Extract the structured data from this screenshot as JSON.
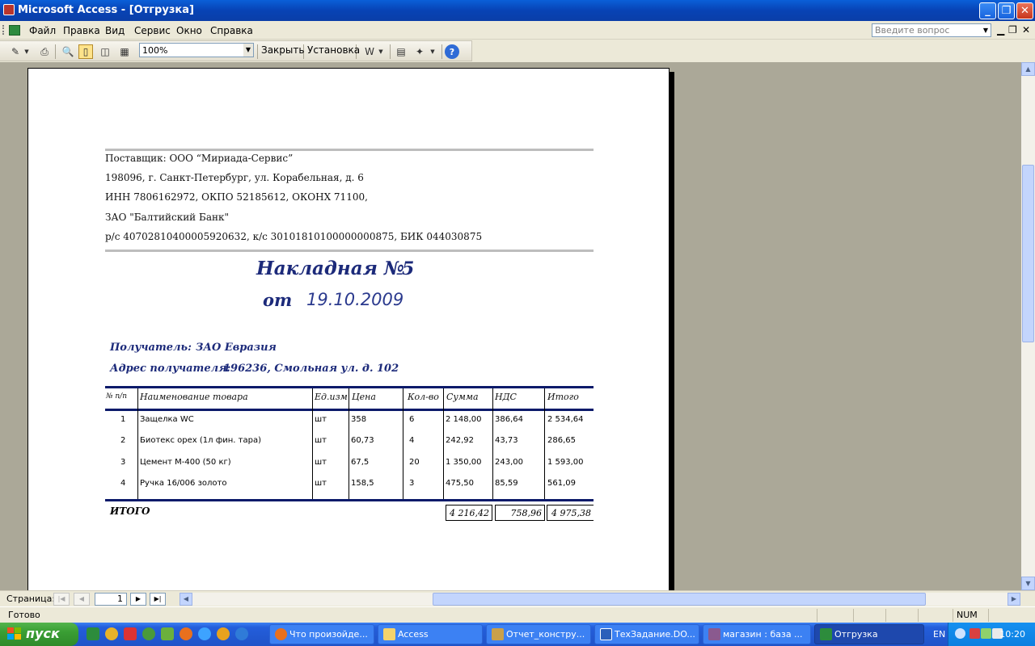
{
  "window": {
    "title": "Microsoft Access - [Отгрузка]",
    "minimize_glyph": "_",
    "restore_glyph": "❐",
    "close_glyph": "✕"
  },
  "menubar": {
    "items": [
      {
        "label": "Файл"
      },
      {
        "label": "Правка"
      },
      {
        "label": "Вид"
      },
      {
        "label": "Сервис"
      },
      {
        "label": "Окно"
      },
      {
        "label": "Справка"
      }
    ],
    "ask_placeholder": "Введите вопрос",
    "mdi_min": "▁",
    "mdi_restore": "❐",
    "mdi_close": "✕"
  },
  "toolbar": {
    "zoom": "100%",
    "close_label": "Закрыть",
    "setup_label": "Установка"
  },
  "report": {
    "supplier_lines": [
      "Поставщик: ООО “Мириада-Сервис”",
      "198096, г. Санкт-Петербург, ул. Корабельная, д. 6",
      "ИНН 7806162972, ОКПО 52185612, ОКОНХ 71100,",
      "ЗАО \"Балтийский Банк\"",
      "р/с 40702810400005920632, к/с 30101810100000000875, БИК 044030875"
    ],
    "title": "Накладная №",
    "number": "5",
    "from_label": "от",
    "date": "19.10.2009",
    "recipient_label": "Получатель:",
    "recipient": "ЗАО Евразия",
    "address_label": "Адрес получателя:",
    "address": "196236, Смольная ул. д. 102",
    "columns": [
      "№ п/п",
      "Наименование товара",
      "Ед.изм",
      "Цена",
      "Кол-во",
      "Сумма",
      "НДС",
      "Итого"
    ],
    "rows": [
      [
        "1",
        "Защелка WC",
        "шт",
        "358",
        "6",
        "2 148,00",
        "386,64",
        "2 534,64"
      ],
      [
        "2",
        "Биотекс орех (1л фин. тара)",
        "шт",
        "60,73",
        "4",
        "242,92",
        "43,73",
        "286,65"
      ],
      [
        "3",
        "Цемент М-400 (50 кг)",
        "шт",
        "67,5",
        "20",
        "1 350,00",
        "243,00",
        "1 593,00"
      ],
      [
        "4",
        "Ручка 16/006 золото",
        "шт",
        "158,5",
        "3",
        "475,50",
        "85,59",
        "561,09"
      ]
    ],
    "total_label": "ИТОГО",
    "total_sum": "4 216,42",
    "total_vat": "758,96",
    "total_all": "4 975,38"
  },
  "navigation": {
    "label": "Страница:",
    "page": "1"
  },
  "status": {
    "text": "Готово",
    "num": "NUM"
  },
  "taskbar": {
    "start": "пуск",
    "tasks": [
      {
        "label": "Что произойде..."
      },
      {
        "label": "Access"
      },
      {
        "label": "Отчет_констру..."
      },
      {
        "label": "ТехЗадание.DO..."
      },
      {
        "label": "магазин : база ..."
      },
      {
        "label": "Отгрузка"
      }
    ],
    "lang": "EN",
    "clock": "10:20"
  }
}
